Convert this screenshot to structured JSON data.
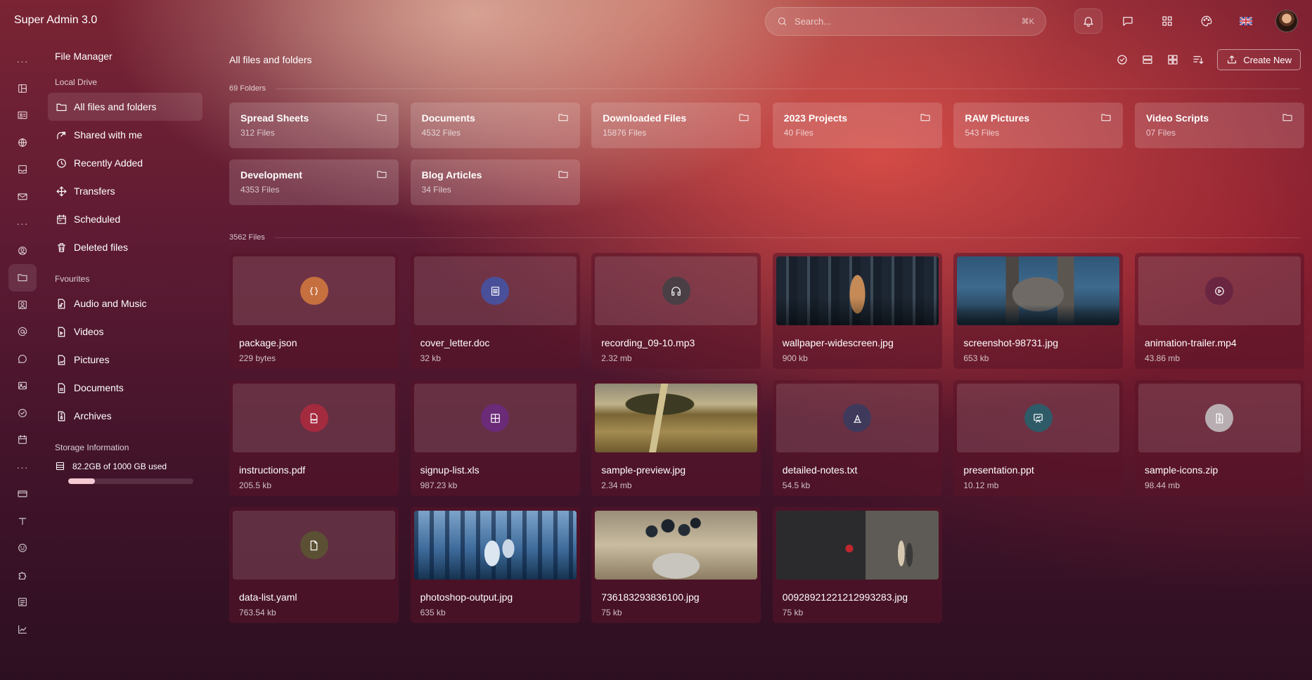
{
  "app": {
    "title": "Super Admin 3.0"
  },
  "search": {
    "placeholder": "Search...",
    "shortcut": "⌘K"
  },
  "top_icons": [
    "bell-icon",
    "chat-icon",
    "apps-grid-icon",
    "palette-icon",
    "uk-flag-icon",
    "user-avatar"
  ],
  "rail_icons": [
    "more-dots",
    "dashboard-icon",
    "id-card-icon",
    "globe-icon",
    "inbox-icon",
    "mail-icon",
    "more-dots",
    "user-circle-icon",
    "folder-icon",
    "contacts-icon",
    "at-sign-icon",
    "message-icon",
    "image-icon",
    "check-circle-icon",
    "calendar-icon",
    "more-dots",
    "card-icon",
    "text-icon",
    "smiley-icon",
    "puzzle-icon",
    "form-icon",
    "chart-line-icon"
  ],
  "sidebar": {
    "title": "File Manager",
    "local_drive": {
      "label": "Local Drive",
      "items": [
        {
          "label": "All files and folders",
          "icon": "folder-icon",
          "active": true
        },
        {
          "label": "Shared with me",
          "icon": "share-icon"
        },
        {
          "label": "Recently Added",
          "icon": "clock-icon"
        },
        {
          "label": "Transfers",
          "icon": "move-icon"
        },
        {
          "label": "Scheduled",
          "icon": "calendar-icon"
        },
        {
          "label": "Deleted files",
          "icon": "trash-icon"
        }
      ]
    },
    "favourites": {
      "label": "Fvourites",
      "items": [
        {
          "label": "Audio and Music",
          "icon": "music-file-icon"
        },
        {
          "label": "Videos",
          "icon": "video-file-icon"
        },
        {
          "label": "Pictures",
          "icon": "image-file-icon"
        },
        {
          "label": "Documents",
          "icon": "doc-file-icon"
        },
        {
          "label": "Archives",
          "icon": "zip-file-icon"
        }
      ]
    },
    "storage": {
      "label": "Storage Information",
      "used_text": "82.2GB of 1000 GB used",
      "used_fraction": 0.082
    }
  },
  "content": {
    "title": "All files and folders",
    "create_label": "Create New",
    "folders_label": "69 Folders",
    "files_label": "3562 Files",
    "folders": [
      {
        "name": "Spread Sheets",
        "count": "312 Files"
      },
      {
        "name": "Documents",
        "count": "4532 Files"
      },
      {
        "name": "Downloaded Files",
        "count": "15876 Files"
      },
      {
        "name": "2023 Projects",
        "count": "40 Files"
      },
      {
        "name": "RAW Pictures",
        "count": "543 Files"
      },
      {
        "name": "Video Scripts",
        "count": "07 Files"
      },
      {
        "name": "Development",
        "count": "4353 Files"
      },
      {
        "name": "Blog Articles",
        "count": "34 Files"
      }
    ],
    "files": [
      {
        "name": "package.json",
        "size": "229 bytes",
        "icon": "code-braces-icon",
        "color": "#c6703f"
      },
      {
        "name": "cover_letter.doc",
        "size": "32 kb",
        "icon": "document-icon",
        "color": "#4a4f9a"
      },
      {
        "name": "recording_09-10.mp3",
        "size": "2.32 mb",
        "icon": "headphones-icon",
        "color": "#4a3f45"
      },
      {
        "name": "wallpaper-widescreen.jpg",
        "size": "900 kb",
        "image": "img-wall"
      },
      {
        "name": "screenshot-98731.jpg",
        "size": "653 kb",
        "image": "img-castle"
      },
      {
        "name": "animation-trailer.mp4",
        "size": "43.86 mb",
        "icon": "play-icon",
        "color": "#6a2540"
      },
      {
        "name": "instructions.pdf",
        "size": "205.5 kb",
        "icon": "pdf-icon",
        "color": "#a42a3e"
      },
      {
        "name": "signup-list.xls",
        "size": "987.23 kb",
        "icon": "table-icon",
        "color": "#6b2b78"
      },
      {
        "name": "sample-preview.jpg",
        "size": "2.34 mb",
        "image": "img-field"
      },
      {
        "name": "detailed-notes.txt",
        "size": "54.5 kb",
        "icon": "text-icon",
        "color": "#3f3a5c"
      },
      {
        "name": "presentation.ppt",
        "size": "10.12 mb",
        "icon": "presentation-icon",
        "color": "#2f5a67"
      },
      {
        "name": "sample-icons.zip",
        "size": "98.44 mb",
        "icon": "zip-icon",
        "color": "#b8aeb2"
      },
      {
        "name": "data-list.yaml",
        "size": "763.54 kb",
        "icon": "file-icon",
        "color": "#5b5033"
      },
      {
        "name": "photoshop-output.jpg",
        "size": "635 kb",
        "image": "img-wolf"
      },
      {
        "name": "736183293836100.jpg",
        "size": "75 kb",
        "image": "img-berries"
      },
      {
        "name": "0092892122121299328‌3.jpg",
        "size": "75 kb",
        "image": "img-train"
      }
    ]
  }
}
